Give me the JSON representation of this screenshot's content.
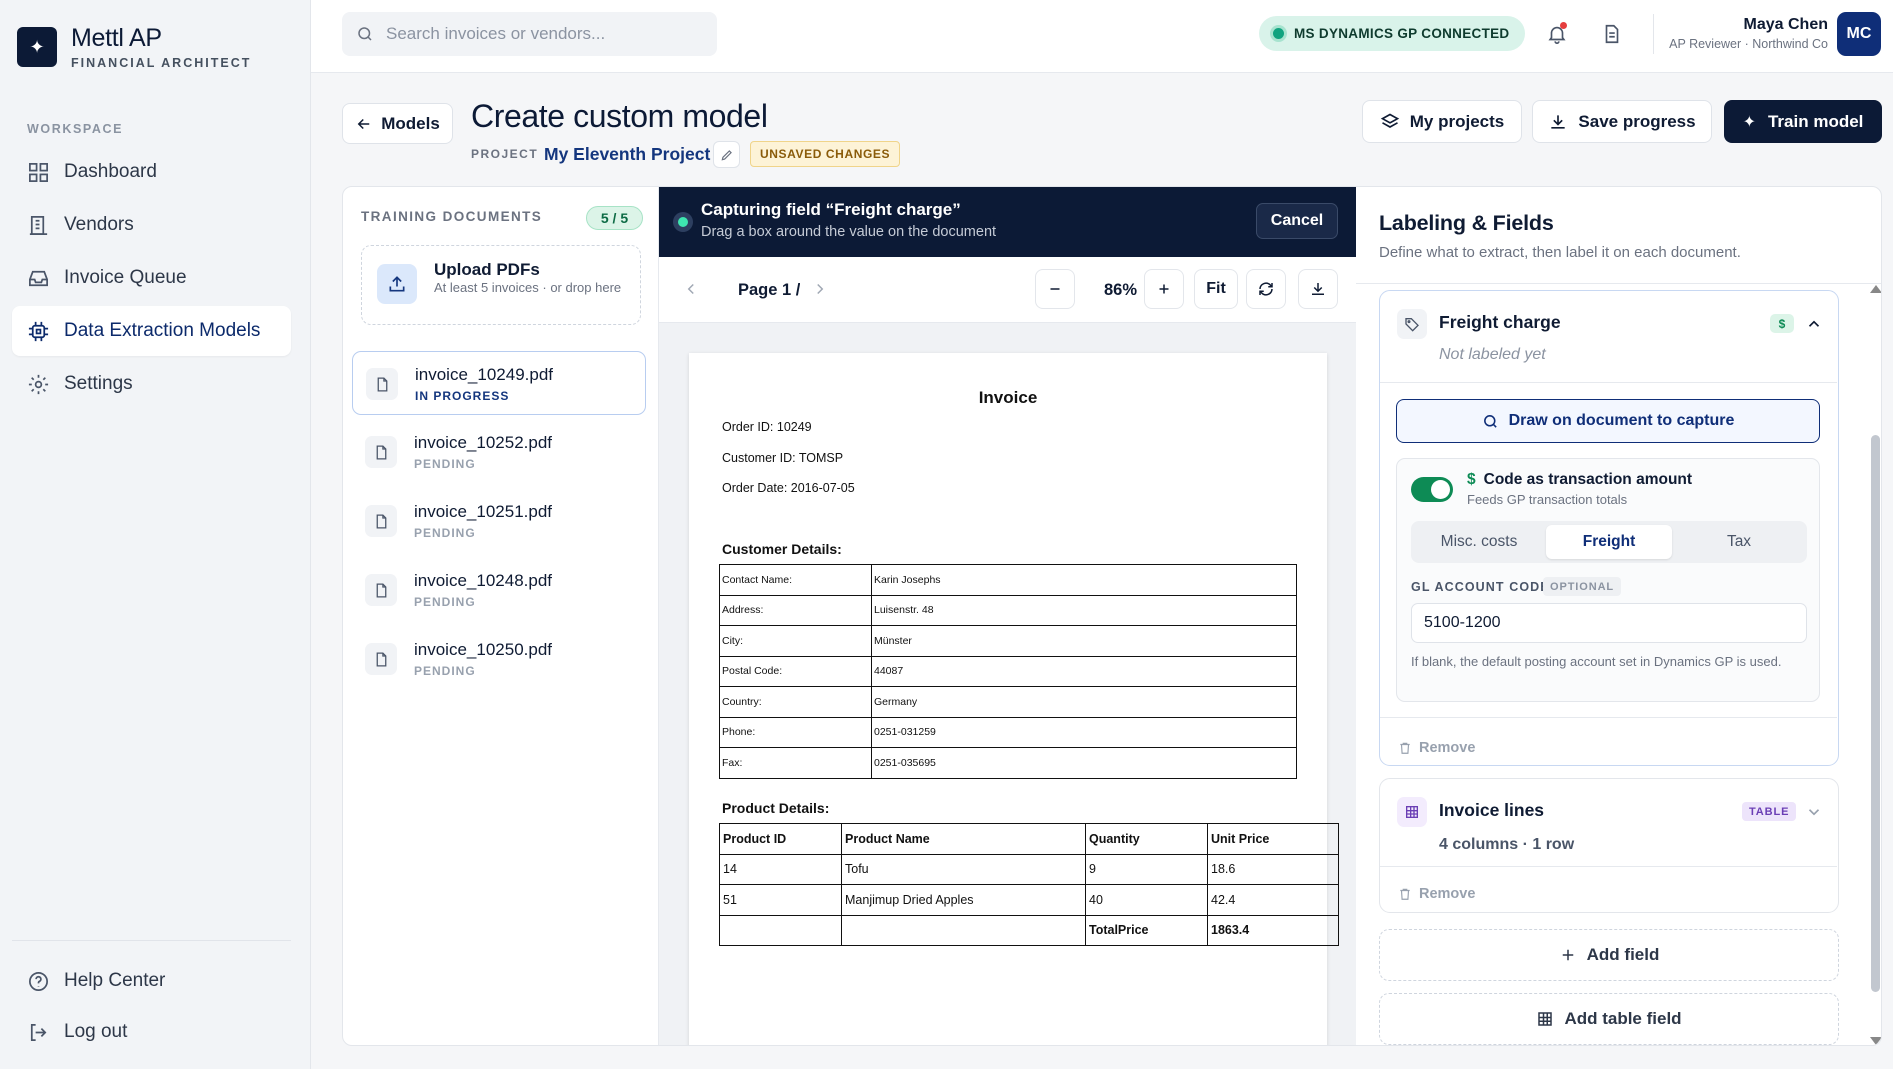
{
  "brand": {
    "name": "Mettl AP",
    "subtitle": "FINANCIAL ARCHITECT"
  },
  "sidebar": {
    "section_label": "WORKSPACE",
    "items": [
      {
        "label": "Dashboard",
        "icon": "dashboard-icon"
      },
      {
        "label": "Vendors",
        "icon": "building-icon"
      },
      {
        "label": "Invoice Queue",
        "icon": "inbox-icon"
      },
      {
        "label": "Data Extraction Models",
        "icon": "chip-icon",
        "active": true
      },
      {
        "label": "Settings",
        "icon": "gear-icon"
      }
    ],
    "bottom": [
      {
        "label": "Help Center",
        "icon": "help-icon"
      },
      {
        "label": "Log out",
        "icon": "logout-icon"
      }
    ]
  },
  "topbar": {
    "search_placeholder": "Search invoices or vendors...",
    "connection_status": "MS DYNAMICS GP CONNECTED",
    "user": {
      "name": "Maya Chen",
      "role": "AP Reviewer · Northwind Co",
      "initials": "MC"
    }
  },
  "header": {
    "back_label": "Models",
    "title": "Create custom model",
    "project_label": "PROJECT",
    "project_name": "My Eleventh Project",
    "unsaved_badge": "UNSAVED CHANGES",
    "my_projects_label": "My projects",
    "save_label": "Save progress",
    "train_label": "Train model"
  },
  "training_docs": {
    "heading": "TRAINING DOCUMENTS",
    "count": "5 / 5",
    "upload_title": "Upload PDFs",
    "upload_sub": "At least 5 invoices · or drop here",
    "documents": [
      {
        "name": "invoice_10249.pdf",
        "status": "IN PROGRESS"
      },
      {
        "name": "invoice_10252.pdf",
        "status": "PENDING"
      },
      {
        "name": "invoice_10251.pdf",
        "status": "PENDING"
      },
      {
        "name": "invoice_10248.pdf",
        "status": "PENDING"
      },
      {
        "name": "invoice_10250.pdf",
        "status": "PENDING"
      }
    ]
  },
  "capture": {
    "title": "Capturing field “Freight charge”",
    "subtitle": "Drag a box around the value on the document",
    "cancel_label": "Cancel"
  },
  "viewer": {
    "page_label": "Page 1 / 1",
    "zoom": "86%",
    "fit_label": "Fit"
  },
  "invoice": {
    "title": "Invoice",
    "order_id": "Order ID: 10249",
    "customer_id": "Customer ID: TOMSP",
    "order_date": "Order Date: 2016-07-05",
    "customer_heading": "Customer Details:",
    "customer_rows": [
      [
        "Contact Name:",
        "Karin Josephs"
      ],
      [
        "Address:",
        "Luisenstr. 48"
      ],
      [
        "City:",
        "Münster"
      ],
      [
        "Postal Code:",
        "44087"
      ],
      [
        "Country:",
        "Germany"
      ],
      [
        "Phone:",
        "0251-031259"
      ],
      [
        "Fax:",
        "0251-035695"
      ]
    ],
    "product_heading": "Product Details:",
    "product_header": [
      "Product ID",
      "Product Name",
      "Quantity",
      "Unit Price"
    ],
    "product_rows": [
      [
        "14",
        "Tofu",
        "9",
        "18.6"
      ],
      [
        "51",
        "Manjimup Dried Apples",
        "40",
        "42.4"
      ],
      [
        "",
        "",
        "TotalPrice",
        "1863.4"
      ]
    ]
  },
  "fields_panel": {
    "title": "Labeling & Fields",
    "subtitle": "Define what to extract, then label it on each document.",
    "freight": {
      "name": "Freight charge",
      "status": "Not labeled yet",
      "badge": "$",
      "draw_label": "Draw on document to capture",
      "txn_title": "Code as transaction amount",
      "txn_sub": "Feeds GP transaction totals",
      "segments": [
        "Misc. costs",
        "Freight",
        "Tax"
      ],
      "selected_segment": "Freight",
      "gl_label": "GL ACCOUNT CODE",
      "gl_optional": "OPTIONAL",
      "gl_value": "5100-1200",
      "gl_help": "If blank, the default posting account set in Dynamics GP is used.",
      "remove_label": "Remove"
    },
    "invoice_lines": {
      "name": "Invoice lines",
      "badge": "TABLE",
      "meta": "4 columns · 1 row",
      "remove_label": "Remove"
    },
    "add_field_label": "Add field",
    "add_table_label": "Add table field"
  }
}
